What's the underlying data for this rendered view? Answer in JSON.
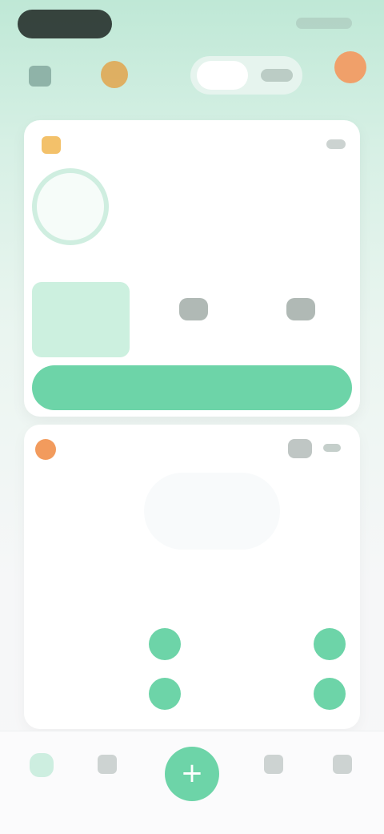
{
  "colors": {
    "accent": "#6dd4a8",
    "accent_light": "#cdeee0",
    "text": "#2f3a36",
    "muted": "#9aa4a0",
    "warning": "#f29b5d"
  },
  "header": {
    "menu_icon": "grid-icon",
    "notification_icon": "bell-icon",
    "segmented": {
      "left": "",
      "right": ""
    },
    "avatar_icon": "user-avatar"
  },
  "card1": {
    "icon": "sun-icon",
    "title": "",
    "more_icon": "more-icon",
    "ring_value": "",
    "ring_caption": "",
    "description_line1": "",
    "description_line2": "",
    "feature_box_label": "",
    "options": [
      {
        "icon": "option-icon",
        "label": ""
      },
      {
        "icon": "option-icon",
        "label": ""
      }
    ],
    "cta_label": ""
  },
  "card2": {
    "icon": "flame-icon",
    "title": "",
    "actions_icon": "filter-icon",
    "arrow_icon": "chevron-right-icon",
    "score": "",
    "score_caption": "",
    "left_tick": "",
    "right_tick": "",
    "metrics": [
      "",
      "",
      ""
    ],
    "rows": [
      {
        "label": "",
        "button": ""
      },
      {
        "label": "",
        "button": ""
      },
      {
        "label": "",
        "button": ""
      },
      {
        "label": "",
        "button": ""
      }
    ]
  },
  "tabbar": {
    "tabs": [
      {
        "icon": "home-icon",
        "label": ""
      },
      {
        "icon": "list-icon",
        "label": ""
      },
      {
        "icon": "chart-icon",
        "label": ""
      },
      {
        "icon": "profile-icon",
        "label": ""
      }
    ],
    "fab_label": "+"
  }
}
